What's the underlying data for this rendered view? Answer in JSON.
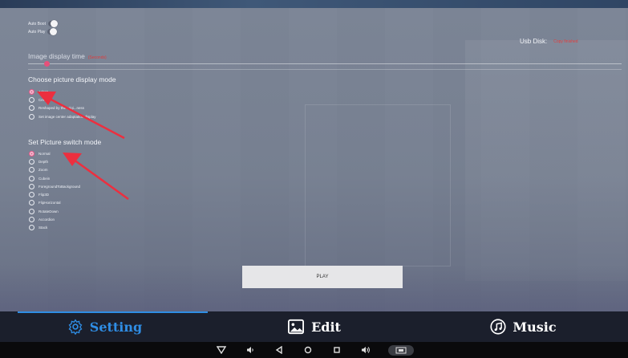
{
  "toggles": [
    {
      "label": "Auto Boot"
    },
    {
      "label": "Auto Play"
    }
  ],
  "usb": {
    "label": "Usb Disk:",
    "status": "Copy finished"
  },
  "image_time": {
    "title": "Image display time",
    "unit": "(Seconds)"
  },
  "display_mode": {
    "title": "Choose picture display mode",
    "options": [
      {
        "label": "Adapt",
        "checked": true
      },
      {
        "label": "Center",
        "checked": false
      },
      {
        "label": "Reshaped by the origi...ness",
        "checked": false
      },
      {
        "label": "Set image center adaptation display",
        "checked": false
      }
    ]
  },
  "switch_mode": {
    "title": "Set Picture switch mode",
    "options": [
      {
        "label": "Normal",
        "checked": true
      },
      {
        "label": "Depth",
        "checked": false
      },
      {
        "label": "Zoom",
        "checked": false
      },
      {
        "label": "Cubein",
        "checked": false
      },
      {
        "label": "ForegroundToBackground",
        "checked": false
      },
      {
        "label": "Flip3D",
        "checked": false
      },
      {
        "label": "FlipHorizontal",
        "checked": false
      },
      {
        "label": "RotateDown",
        "checked": false
      },
      {
        "label": "Accordion",
        "checked": false
      },
      {
        "label": "Stack",
        "checked": false
      }
    ]
  },
  "play_button": {
    "label": "PLAY"
  },
  "tabs": [
    {
      "label": "Setting",
      "icon": "gear-icon",
      "active": true
    },
    {
      "label": "Edit",
      "icon": "image-icon",
      "active": false
    },
    {
      "label": "Music",
      "icon": "music-icon",
      "active": false
    }
  ],
  "colors": {
    "accent": "#2f8de4",
    "radio_checked": "#e25a8a",
    "status_red": "#e23b3b"
  }
}
